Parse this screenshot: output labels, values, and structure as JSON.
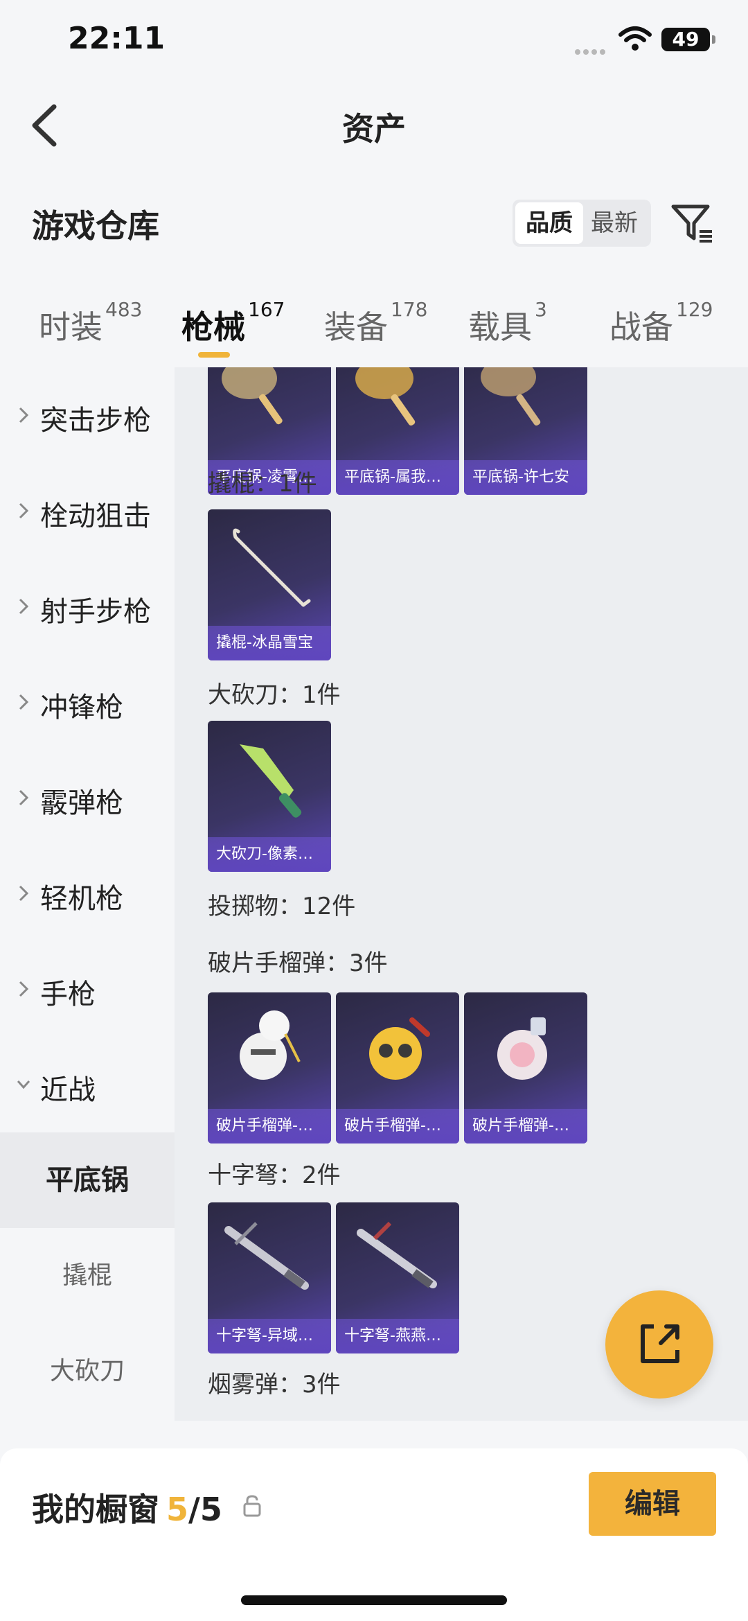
{
  "status_bar": {
    "time": "22:11",
    "battery": "49"
  },
  "nav": {
    "title": "资产"
  },
  "warehouse": {
    "title": "游戏仓库",
    "sort": [
      "品质",
      "最新"
    ]
  },
  "tabs": [
    {
      "label": "时装",
      "count": "483"
    },
    {
      "label": "枪械",
      "count": "167"
    },
    {
      "label": "装备",
      "count": "178"
    },
    {
      "label": "载具",
      "count": "3"
    },
    {
      "label": "战备",
      "count": "129"
    }
  ],
  "sidebar": {
    "categories": [
      "突击步枪",
      "栓动狙击",
      "射手步枪",
      "冲锋枪",
      "霰弹枪",
      "轻机枪",
      "手枪",
      "近战"
    ],
    "subs": [
      "平底锅",
      "撬棍",
      "大砍刀"
    ]
  },
  "content": {
    "top_cards": [
      "平底锅-凌霄…",
      "平底锅-属我…",
      "平底锅-许七安"
    ],
    "sections": [
      {
        "title": "撬棍：1件",
        "cards": [
          "撬棍-冰晶雪宝"
        ]
      },
      {
        "title": "大砍刀：1件",
        "cards": [
          "大砍刀-像素…"
        ]
      },
      {
        "title": "投掷物：12件"
      },
      {
        "title": "破片手榴弹：3件",
        "cards": [
          "破片手榴弹-…",
          "破片手榴弹-…",
          "破片手榴弹-…"
        ]
      },
      {
        "title": "十字弩：2件",
        "cards": [
          "十字弩-异域…",
          "十字弩-燕燕…"
        ]
      },
      {
        "title": "烟雾弹：3件"
      }
    ]
  },
  "showcase": {
    "label": "我的橱窗",
    "count_current": "5",
    "count_sep": "/5",
    "edit_label": "编辑"
  },
  "colors": {
    "accent": "#f3b33c",
    "card_gradient_end": "#5a46b3",
    "background": "#f5f6f8"
  }
}
